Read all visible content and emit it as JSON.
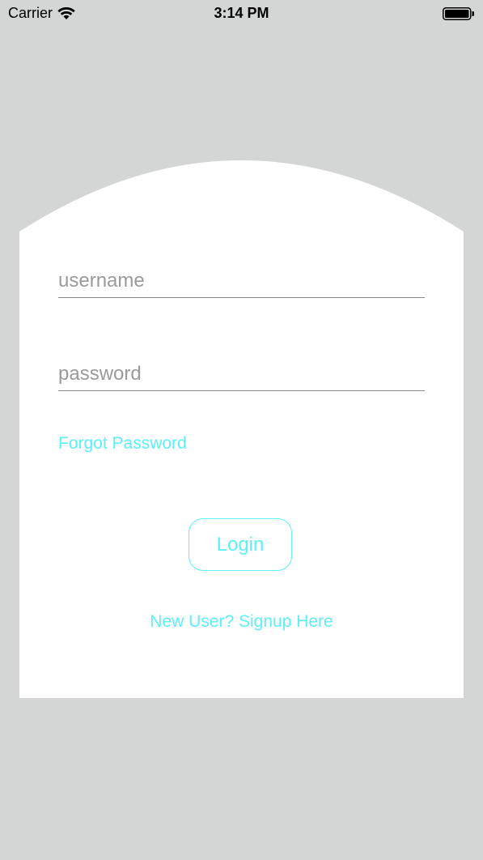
{
  "status_bar": {
    "carrier": "Carrier",
    "time": "3:14 PM",
    "wifi_icon": "wifi-icon",
    "battery_icon": "battery-icon"
  },
  "login_form": {
    "username_placeholder": "username",
    "username_value": "",
    "password_placeholder": "password",
    "password_value": "",
    "forgot_password_label": "Forgot Password",
    "login_label": "Login",
    "signup_label": "New User? Signup Here"
  },
  "colors": {
    "background": "#d4d5d5",
    "card": "#ffffff",
    "accent": "#5cf0f7",
    "input_underline": "#8a8a8a",
    "placeholder": "#9a9a9a"
  }
}
